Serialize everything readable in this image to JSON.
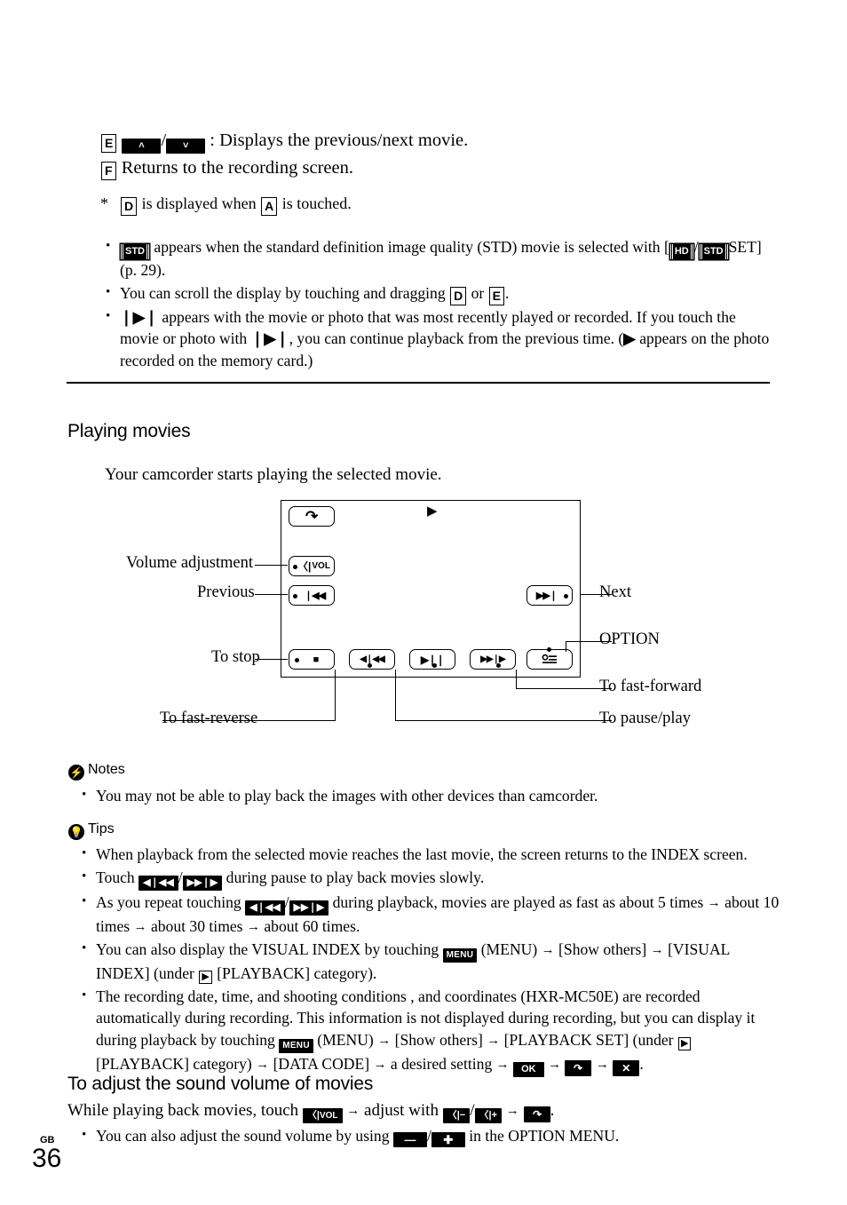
{
  "top": {
    "line_e_label": "E",
    "line_e_btn_prev": "˄",
    "line_e_btn_next": "˅",
    "line_e_text": ": Displays the previous/next movie.",
    "line_f_label": "F",
    "line_f_text": "Returns to the recording screen.",
    "footnote_star": "*",
    "footnote_box1": "D",
    "footnote_mid": "is displayed when",
    "footnote_box2": "A",
    "footnote_end": "is touched."
  },
  "bullets_top": [
    {
      "icon_std": "STD",
      "t1": "appears when the standard definition image quality (STD) movie is selected with [",
      "icon_hd": "HD",
      "t2": "/",
      "icon_std2": "STD",
      "t3": "SET] (p. 29)."
    },
    {
      "t1": "You can scroll the display by touching and dragging",
      "box1": "D",
      "t2": "or",
      "box2": "E",
      "t3": "."
    },
    {
      "icon_resume": "❘▶❘",
      "t1": "appears with the movie or photo that was most recently played or recorded. If you touch the movie or photo with",
      "icon_resume2": "❘▶❘",
      "t2": ", you can continue playback from the previous time. (",
      "icon_play": "▶",
      "t3": "appears on the photo recorded on the memory card.)"
    }
  ],
  "section_playing": {
    "heading": "Playing movies",
    "intro": "Your camcorder starts playing the selected movie."
  },
  "diagram": {
    "screen_buttons": {
      "back": "↶",
      "play_indicator": "▶",
      "volume": "VOL",
      "previous": "❘◀◀",
      "stop": "■",
      "fast_reverse": "◀❘◀◀",
      "pause_play": "▶❘❘",
      "fast_forward": "▶▶❘▶",
      "option": "OPTION-icon",
      "next": "▶▶❘"
    },
    "callouts": {
      "volume": "Volume adjustment",
      "previous": "Previous",
      "stop": "To stop",
      "fast_reverse": "To fast-reverse",
      "next": "Next",
      "option": "OPTION",
      "fast_forward": "To fast-forward",
      "pause_play": "To pause/play"
    }
  },
  "notes": {
    "heading": "Notes",
    "badge": "⚡",
    "items": [
      "You may not be able to play back the images with other devices than camcorder."
    ]
  },
  "tips": {
    "heading": "Tips",
    "badge": "☀",
    "items": [
      {
        "kind": "plain",
        "text": "When playback from the selected movie reaches the last movie, the screen returns to the INDEX screen."
      },
      {
        "kind": "touch_slow",
        "t1": "Touch",
        "icon_a": "◀❘◀◀",
        "sep": "/",
        "icon_b": "▶▶❘▶",
        "t2": "during pause to play back movies slowly."
      },
      {
        "kind": "repeat_speed",
        "t1": "As you repeat touching",
        "icon_a": "◀❘◀◀",
        "sep": "/",
        "icon_b": "▶▶❘▶",
        "t2": "during playback, movies are played as fast as about 5 times",
        "arrow": "→",
        "t3": "about 10 times",
        "t4": "about 30 times",
        "t5": "about 60 times."
      },
      {
        "kind": "visual_index",
        "t1": "You can also display the VISUAL INDEX by touching",
        "icon_menu": "MENU",
        "t2": "(MENU)",
        "arrow": "→",
        "t3": "[Show others]",
        "t4": "[VISUAL INDEX] (under",
        "icon_playback": "▶",
        "t5": "[PLAYBACK] category)."
      },
      {
        "kind": "data_code",
        "t1": "The recording date, time, and shooting conditions , and coordinates (HXR-MC50E) are recorded automatically during recording. This information is not displayed during recording, but you can display it during playback by touching",
        "icon_menu": "MENU",
        "t2": "(MENU)",
        "arrow": "→",
        "t3": "[Show others]",
        "t4": "[PLAYBACK SET] (under",
        "icon_playback": "▶",
        "t5": "[PLAYBACK] category)",
        "t6": "[DATA CODE]",
        "t7": "a desired setting",
        "icon_ok": "OK",
        "icon_back": "↶",
        "icon_close": "✕",
        "t8": "."
      }
    ]
  },
  "section_volume": {
    "heading": "To adjust the sound volume of movies",
    "line": {
      "t1": "While playing back movies, touch",
      "icon_vol": "VOL",
      "arrow": "→",
      "t2": "adjust with",
      "icon_minus": "−",
      "sep": "/",
      "icon_plus": "+",
      "icon_back": "↶",
      "t3": "."
    },
    "bullet": {
      "t1": "You can also adjust the sound volume by using",
      "icon_minus": "—",
      "sep": "/",
      "icon_plus": "✚",
      "t2": "in the OPTION MENU."
    }
  },
  "footer": {
    "region": "GB",
    "page": "36"
  }
}
